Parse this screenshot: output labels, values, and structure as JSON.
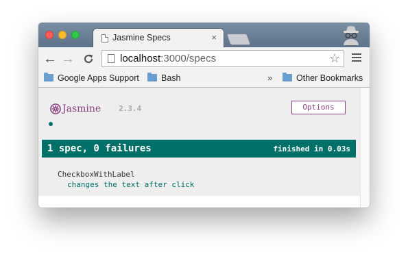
{
  "browser": {
    "tab": {
      "title": "Jasmine Specs",
      "close_glyph": "×"
    },
    "toolbar": {
      "back_glyph": "←",
      "forward_glyph": "→",
      "reload_glyph": "C",
      "url_host": "localhost",
      "url_path": ":3000/specs",
      "star_glyph": "☆"
    },
    "bookmarks": [
      {
        "label": "Google Apps Support",
        "icon": "folder-icon"
      },
      {
        "label": "Bash",
        "icon": "folder-icon"
      }
    ],
    "bookmarks_overflow": "»",
    "other_bookmarks": {
      "label": "Other Bookmarks",
      "icon": "folder-icon"
    }
  },
  "jasmine": {
    "logo_text": "Jasmine",
    "version": "2.3.4",
    "options_label": "Options",
    "summary": {
      "overall": "1 spec, 0 failures",
      "duration": "finished in 0.03s"
    },
    "suite": "CheckboxWithLabel",
    "spec": "changes the text after click",
    "colors": {
      "brand_purple": "#8a4182",
      "pass_green": "#007069"
    }
  }
}
